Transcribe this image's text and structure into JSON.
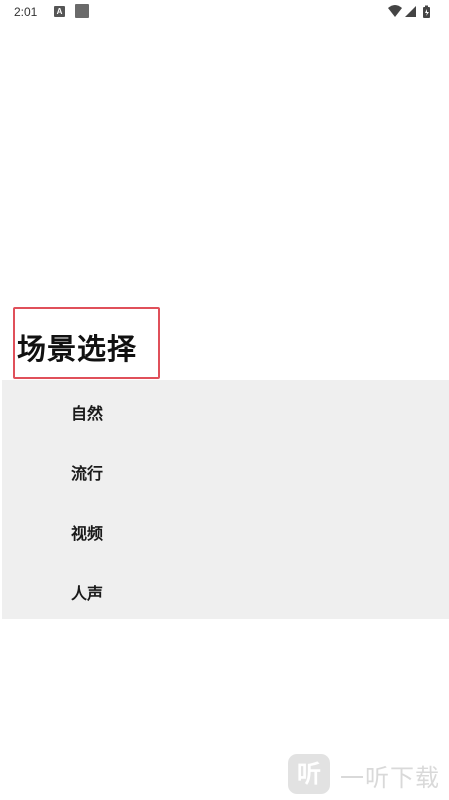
{
  "status_bar": {
    "time": "2:01",
    "notification_a_label": "A"
  },
  "title": "场景选择",
  "scenes": [
    {
      "label": "自然"
    },
    {
      "label": "流行"
    },
    {
      "label": "视频"
    },
    {
      "label": "人声"
    }
  ],
  "watermark": {
    "logo_glyph": "听",
    "text": "一听下载"
  },
  "colors": {
    "background": "#ffffff",
    "list_background": "#efefef",
    "highlight_border": "#e0505a",
    "text": "#111111"
  },
  "icons": [
    "notification-a-icon",
    "notification-square-icon",
    "wifi-icon",
    "cell-signal-icon",
    "battery-icon"
  ]
}
